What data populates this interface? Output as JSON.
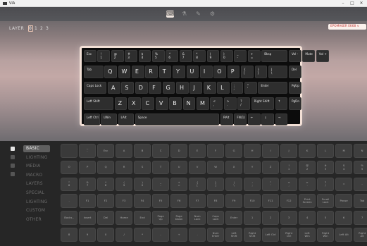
{
  "window": {
    "title": "VIA"
  },
  "nav": {
    "icons": [
      "configure-icon",
      "tester-icon",
      "design-icon",
      "settings-icon"
    ]
  },
  "layers": {
    "label": "LAYER",
    "items": [
      "0",
      "1",
      "2",
      "3"
    ],
    "selected": 0
  },
  "keyboard_select": {
    "value": "EPOMAKER EK68 ∨"
  },
  "keyboard": {
    "rows": [
      [
        {
          "l": "Esc"
        },
        {
          "l": "!\n1"
        },
        {
          "l": "@\n2"
        },
        {
          "l": "#\n3"
        },
        {
          "l": "$\n4"
        },
        {
          "l": "%\n5"
        },
        {
          "l": "^\n6"
        },
        {
          "l": "&\n7"
        },
        {
          "l": "*\n8"
        },
        {
          "l": "(\n9"
        },
        {
          "l": ")\n0"
        },
        {
          "l": "_\n-"
        },
        {
          "l": "+\n="
        },
        {
          "l": "Bksp"
        },
        {
          "l": "Vol -"
        },
        {
          "l": "Mute"
        },
        {
          "l": "Vol +"
        }
      ],
      [
        {
          "l": "Tab"
        },
        {
          "l": "Q"
        },
        {
          "l": "W"
        },
        {
          "l": "E"
        },
        {
          "l": "R"
        },
        {
          "l": "T"
        },
        {
          "l": "Y"
        },
        {
          "l": "U"
        },
        {
          "l": "I"
        },
        {
          "l": "O"
        },
        {
          "l": "P"
        },
        {
          "l": "{\n["
        },
        {
          "l": "}\n]"
        },
        {
          "l": "|\n\\"
        },
        {
          "l": "Del"
        }
      ],
      [
        {
          "l": "Caps Lock"
        },
        {
          "l": "A"
        },
        {
          "l": "S"
        },
        {
          "l": "D"
        },
        {
          "l": "F"
        },
        {
          "l": "G"
        },
        {
          "l": "H"
        },
        {
          "l": "J"
        },
        {
          "l": "K"
        },
        {
          "l": "L"
        },
        {
          "l": ":\n;"
        },
        {
          "l": "\"\n'"
        },
        {
          "l": "Enter"
        },
        {
          "l": "PgUp"
        }
      ],
      [
        {
          "l": "Left Shift"
        },
        {
          "l": "Z"
        },
        {
          "l": "X"
        },
        {
          "l": "C"
        },
        {
          "l": "V"
        },
        {
          "l": "B"
        },
        {
          "l": "N"
        },
        {
          "l": "M"
        },
        {
          "l": "<\n,"
        },
        {
          "l": ">\n."
        },
        {
          "l": "?\n/"
        },
        {
          "l": "Right Shift"
        },
        {
          "l": "↑"
        },
        {
          "l": "PgDn"
        }
      ],
      [
        {
          "l": "Left Ctrl"
        },
        {
          "l": "LWin"
        },
        {
          "l": "LAlt"
        },
        {
          "l": "Space"
        },
        {
          "l": "RAlt"
        },
        {
          "l": "FN(1)"
        },
        {
          "l": "←"
        },
        {
          "l": "↓"
        },
        {
          "l": "→"
        }
      ]
    ]
  },
  "categories": {
    "items": [
      "BASIC",
      "LIGHTING",
      "MEDIA",
      "MACRO",
      "LAYERS",
      "SPECIAL",
      "LIGHTING",
      "CUSTOM",
      "OTHER"
    ],
    "selected": 0
  },
  "keycode_grid": {
    "rows": [
      [
        "",
        "~\n`",
        "Esc",
        "A",
        "B",
        "C",
        "D",
        "E",
        "F",
        "G",
        "H",
        "I",
        "J",
        "K",
        "L",
        "M",
        "N"
      ],
      [
        "O",
        "P",
        "Q",
        "R",
        "S",
        "T",
        "U",
        "V",
        "W",
        "X",
        "Y",
        "Z",
        "!\n1",
        "@\n2",
        "#\n3",
        "$\n4",
        "%\n5"
      ],
      [
        "^\n6",
        "&\n7",
        "*\n8",
        "(\n9",
        ")\n0",
        "_\n-",
        "+\n=",
        "{\n[",
        "}\n]",
        "|\n\\",
        ":\n;",
        "\"\n'",
        "<\n,",
        ">\n.",
        "?\n/",
        "=",
        "-"
      ],
      [
        ".",
        "F1",
        "F2",
        "F3",
        "F4",
        "F5",
        "F6",
        "F7",
        "F8",
        "F9",
        "F10",
        "F11",
        "F12",
        "Print\nScreen",
        "Scroll\nLock",
        "Pause",
        "Tab"
      ],
      [
        "Backs..",
        "Insert",
        "Del",
        "Home",
        "End",
        "Page\nUp",
        "Page\nDown",
        "Num\nLock",
        "Caps\nLock",
        "Enter",
        "1",
        "2",
        "3",
        "4",
        "5",
        "6",
        "7"
      ],
      [
        "8",
        "9",
        "0",
        "/",
        "*",
        "-",
        "+",
        ".",
        "Num\nEnter",
        "Left\nShift",
        "Right\nShift",
        "Left Ctrl",
        "Right\nCtrl",
        "Left\nWin",
        "Right\nWin",
        "Left Alt",
        "Right\nAlt"
      ]
    ]
  }
}
